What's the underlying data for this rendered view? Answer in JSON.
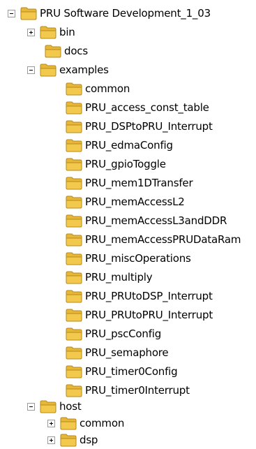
{
  "tree": {
    "root": {
      "label": "PRU Software Development_1_03",
      "children": {
        "bin": {
          "label": "bin"
        },
        "docs": {
          "label": "docs"
        },
        "examples": {
          "label": "examples",
          "items": [
            "common",
            "PRU_access_const_table",
            "PRU_DSPtoPRU_Interrupt",
            "PRU_edmaConfig",
            "PRU_gpioToggle",
            "PRU_mem1DTransfer",
            "PRU_memAccessL2",
            "PRU_memAccessL3andDDR",
            "PRU_memAccessPRUDataRam",
            "PRU_miscOperations",
            "PRU_multiply",
            "PRU_PRUtoDSP_Interrupt",
            "PRU_PRUtoPRU_Interrupt",
            "PRU_pscConfig",
            "PRU_semaphore",
            "PRU_timer0Config",
            "PRU_timer0Interrupt"
          ]
        },
        "host": {
          "label": "host",
          "items": [
            "common",
            "dsp"
          ]
        }
      }
    }
  },
  "colors": {
    "folder_body": "#f2c94c",
    "folder_tab": "#e7b73a",
    "folder_outline": "#b58a1a"
  },
  "icons": {
    "folder": "folder-icon",
    "expand": "expand-icon",
    "collapse": "collapse-icon"
  }
}
